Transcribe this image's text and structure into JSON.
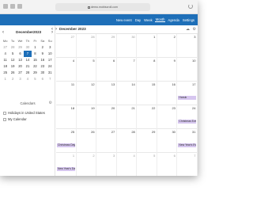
{
  "browser": {
    "url": "demo.mobiscroll.com"
  },
  "header": {
    "nav": [
      "New event",
      "Day",
      "Week",
      "Month",
      "Agenda",
      "Settings"
    ]
  },
  "mini_calendar": {
    "month": "December",
    "year": "2023",
    "dow": [
      "Mo",
      "Tu",
      "We",
      "Th",
      "Fr",
      "Sa",
      "Su"
    ],
    "weeks": [
      [
        "27",
        "28",
        "29",
        "30",
        "1",
        "2",
        "3"
      ],
      [
        "4",
        "5",
        "6",
        "7",
        "8",
        "9",
        "10"
      ],
      [
        "11",
        "12",
        "13",
        "14",
        "15",
        "16",
        "17"
      ],
      [
        "18",
        "19",
        "20",
        "21",
        "22",
        "23",
        "24"
      ],
      [
        "25",
        "26",
        "27",
        "28",
        "29",
        "30",
        "31"
      ],
      [
        "1",
        "2",
        "3",
        "4",
        "5",
        "6",
        "7"
      ]
    ],
    "today": "7"
  },
  "calendars": {
    "title": "Calendars",
    "items": [
      "Holidays in United States",
      "My Calendar"
    ]
  },
  "main": {
    "title": "December 2023",
    "weeks": [
      [
        "27",
        "28",
        "29",
        "30",
        "1",
        "2",
        "3"
      ],
      [
        "4",
        "5",
        "6",
        "7",
        "8",
        "9",
        "10"
      ],
      [
        "11",
        "12",
        "13",
        "14",
        "15",
        "16",
        "17"
      ],
      [
        "18",
        "19",
        "20",
        "21",
        "22",
        "23",
        "24"
      ],
      [
        "25",
        "26",
        "27",
        "28",
        "29",
        "30",
        "31"
      ],
      [
        "1",
        "2",
        "3",
        "4",
        "5",
        "6",
        "7"
      ]
    ],
    "events": [
      {
        "week": 2,
        "day": 6,
        "label": "Hanuk"
      },
      {
        "week": 3,
        "day": 6,
        "label": "Christmas Eve"
      },
      {
        "week": 4,
        "day": 0,
        "label": "Christmas Day"
      },
      {
        "week": 4,
        "day": 6,
        "label": "New Year's Eve"
      },
      {
        "week": 5,
        "day": 0,
        "label": "New Year's Day"
      }
    ]
  }
}
